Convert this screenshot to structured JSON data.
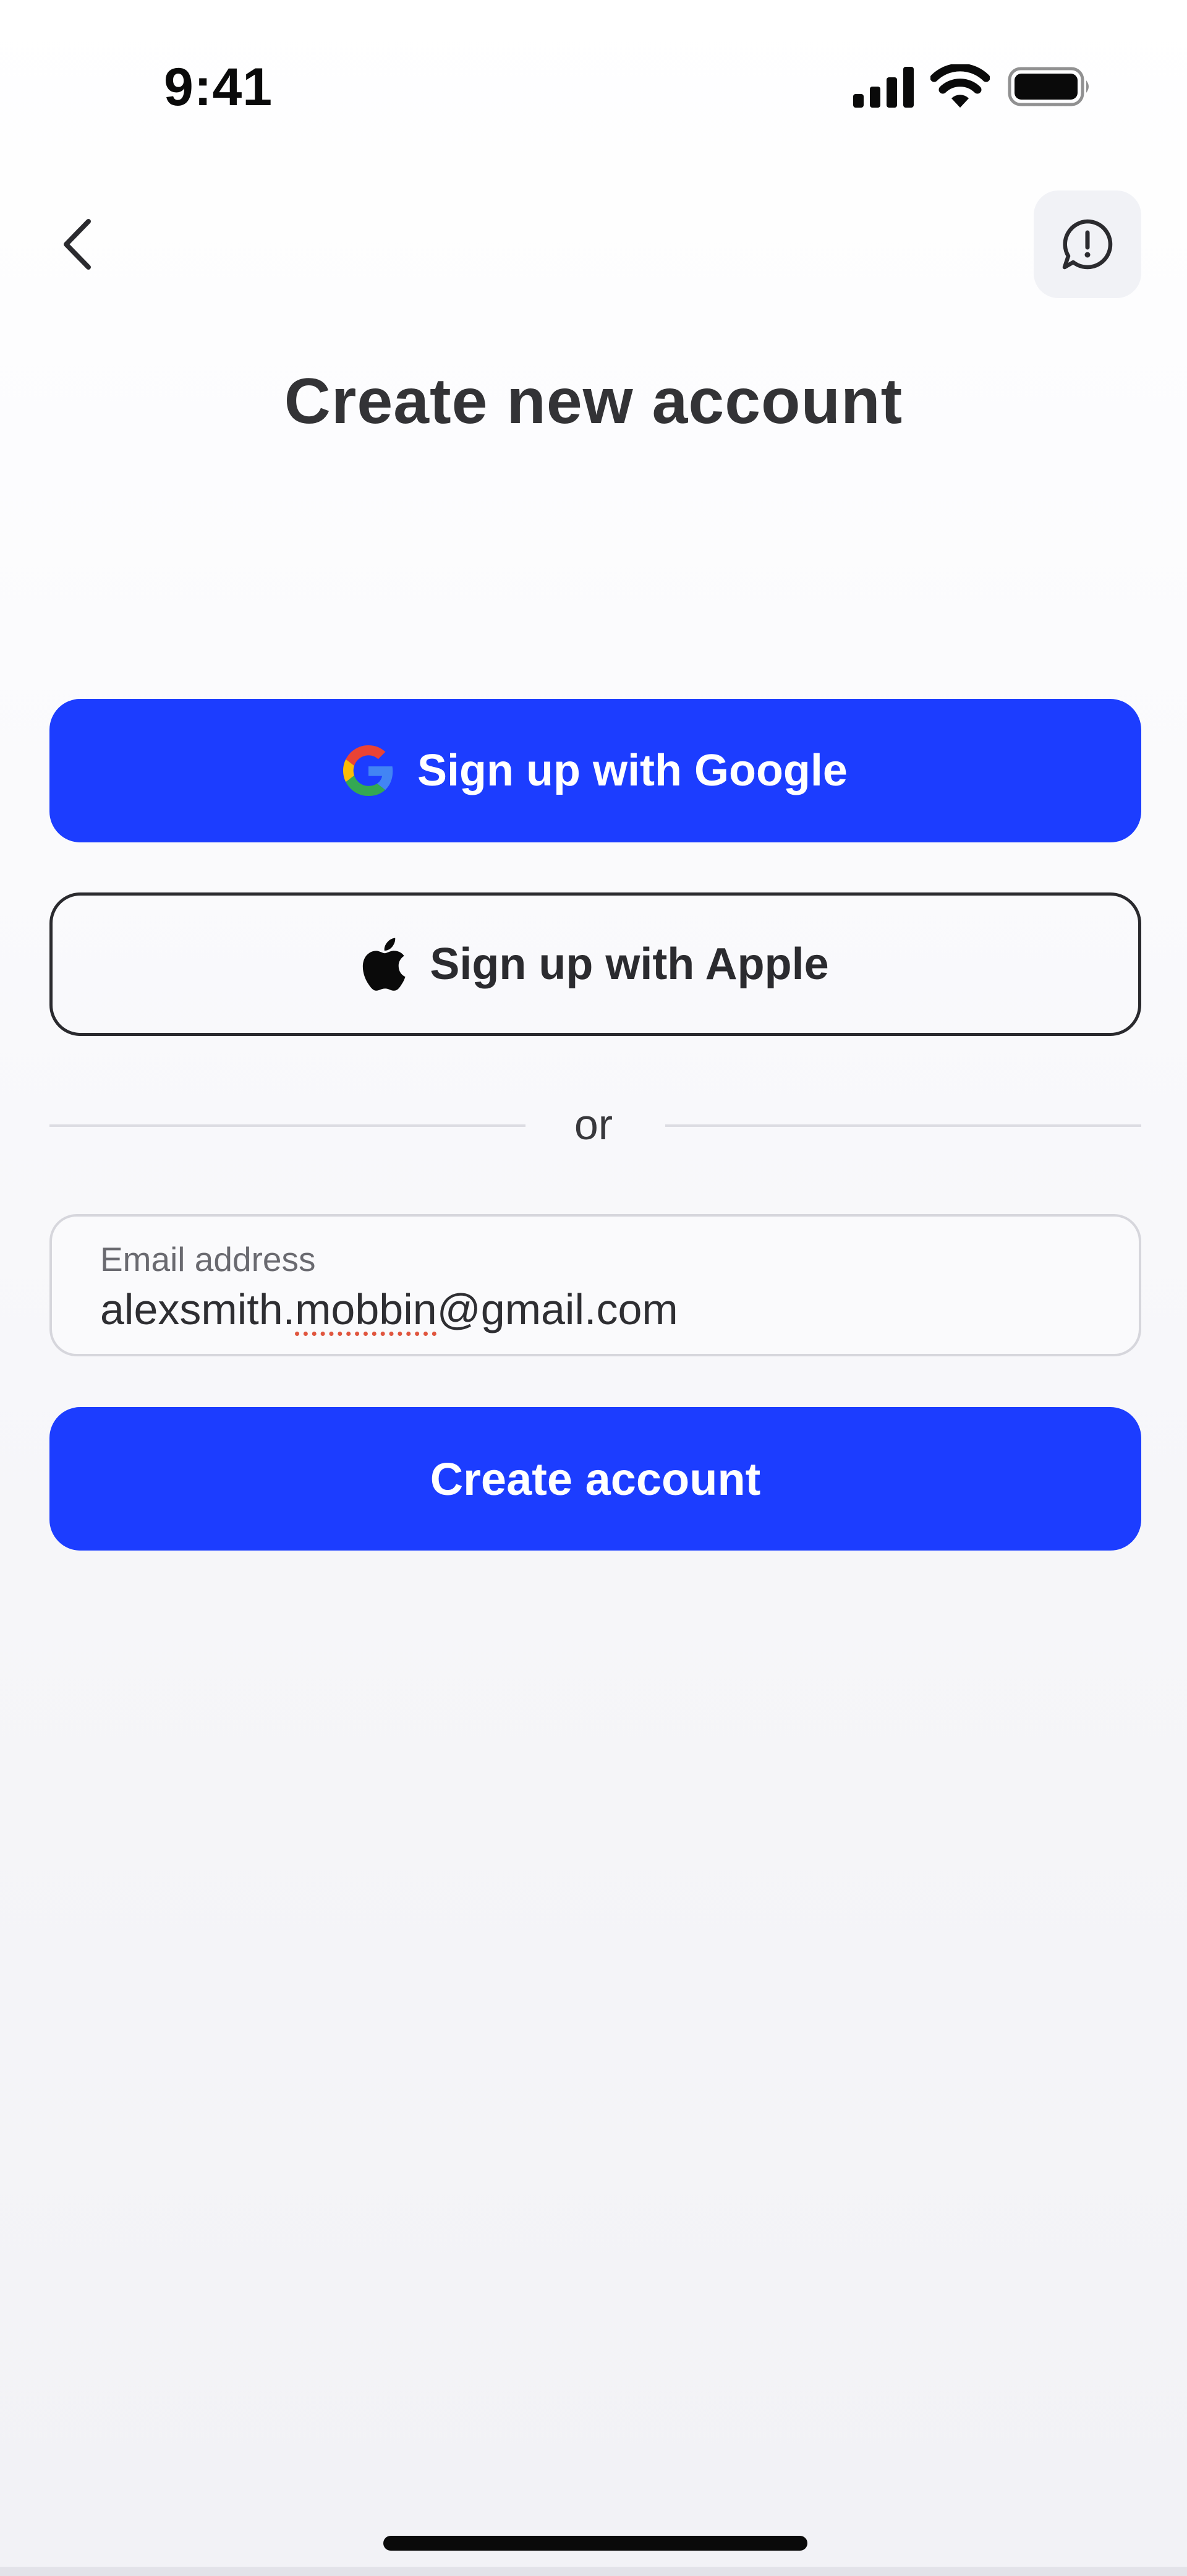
{
  "status_bar": {
    "time": "9:41",
    "signal_icon": "cellular-signal-icon",
    "wifi_icon": "wifi-icon",
    "battery_icon": "battery-icon"
  },
  "nav": {
    "back_icon": "chevron-left-icon",
    "report_icon": "chat-alert-icon"
  },
  "page": {
    "title": "Create new account"
  },
  "social": {
    "google_label": "Sign up with Google",
    "google_icon": "google-logo-icon",
    "apple_label": "Sign up with Apple",
    "apple_icon": "apple-logo-icon"
  },
  "divider": {
    "text": "or"
  },
  "email": {
    "label": "Email address",
    "value_prefix": "alexsmith.",
    "value_misspelled": "mobbin",
    "value_suffix": "@gmail.com"
  },
  "actions": {
    "create_label": "Create account"
  },
  "colors": {
    "primary": "#1c3dff",
    "text": "#2b2b2f",
    "border": "#2a2a2e",
    "spellcheck": "#e0553e"
  }
}
